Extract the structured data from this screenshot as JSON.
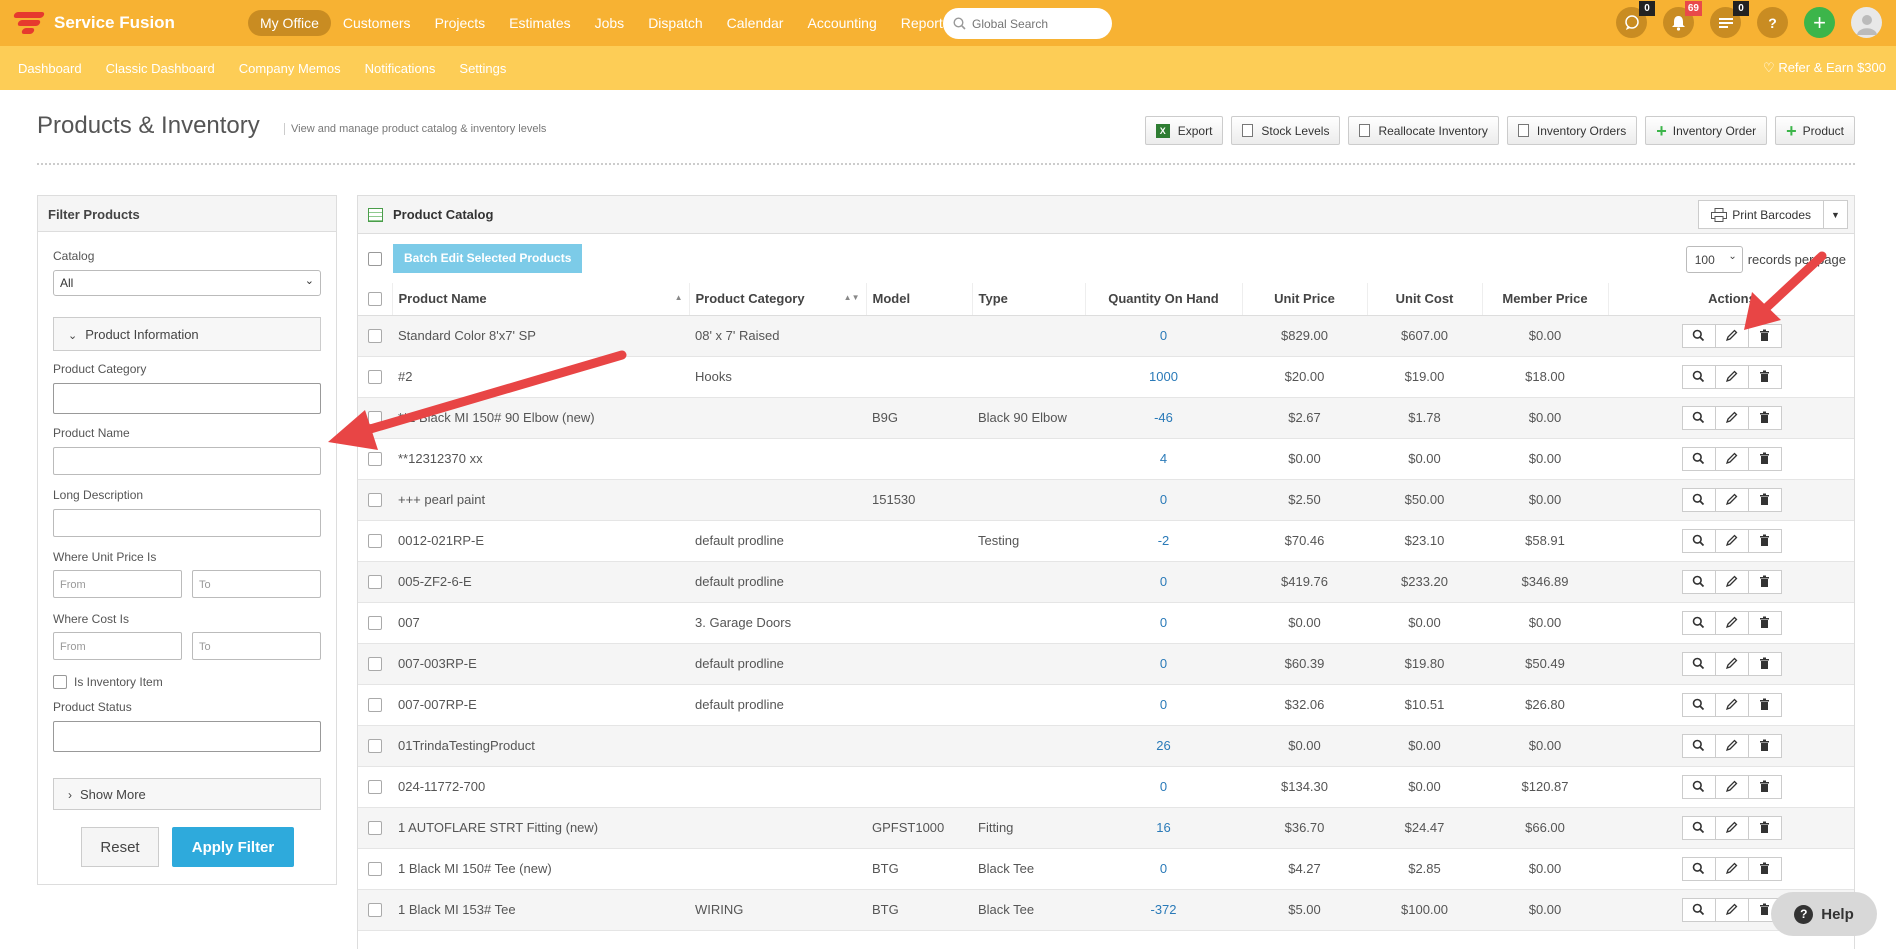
{
  "app": {
    "name": "Service Fusion"
  },
  "nav": {
    "items": [
      "My Office",
      "Customers",
      "Projects",
      "Estimates",
      "Jobs",
      "Dispatch",
      "Calendar",
      "Accounting",
      "Reports"
    ],
    "search_placeholder": "Global Search",
    "badges": {
      "chat": "0",
      "notifications": "69",
      "tasks": "0"
    },
    "help_label": "?",
    "add_label": "+"
  },
  "subnav": {
    "items": [
      "Dashboard",
      "Classic Dashboard",
      "Company Memos",
      "Notifications",
      "Settings"
    ],
    "refer": "♡ Refer & Earn $300"
  },
  "page": {
    "title": "Products & Inventory",
    "subtitle": "View and manage product catalog & inventory levels",
    "buttons": [
      "Export",
      "Stock Levels",
      "Reallocate Inventory",
      "Inventory Orders",
      "Inventory Order",
      "Product"
    ]
  },
  "filter": {
    "title": "Filter Products",
    "catalog_label": "Catalog",
    "catalog_value": "All",
    "product_info": "Product Information",
    "product_category": "Product Category",
    "product_name": "Product Name",
    "long_description": "Long Description",
    "unit_price": "Where Unit Price Is",
    "cost": "Where Cost Is",
    "from": "From",
    "to": "To",
    "inventory_item": "Is Inventory Item",
    "product_status": "Product Status",
    "show_more": "Show More",
    "reset": "Reset",
    "apply": "Apply Filter"
  },
  "catalog": {
    "title": "Product Catalog",
    "print_barcodes": "Print Barcodes",
    "batch_edit": "Batch Edit Selected Products",
    "per_page_value": "100",
    "per_page_label": "records per page",
    "columns": [
      "Product Name",
      "Product Category",
      "Model",
      "Type",
      "Quantity On Hand",
      "Unit Price",
      "Unit Cost",
      "Member Price",
      "Actions"
    ],
    "rows": [
      {
        "name": "Standard Color 8'x7' SP",
        "category": "08' x 7' Raised",
        "model": "",
        "type": "",
        "qty": "0",
        "price": "$829.00",
        "cost": "$607.00",
        "member": "$0.00"
      },
      {
        "name": "#2",
        "category": "Hooks",
        "model": "",
        "type": "",
        "qty": "1000",
        "price": "$20.00",
        "cost": "$19.00",
        "member": "$18.00"
      },
      {
        "name": "**1 Black MI 150# 90 Elbow (new)",
        "category": "",
        "model": "B9G",
        "type": "Black 90 Elbow",
        "qty": "-46",
        "price": "$2.67",
        "cost": "$1.78",
        "member": "$0.00"
      },
      {
        "name": "**12312370 xx",
        "category": "",
        "model": "",
        "type": "",
        "qty": "4",
        "price": "$0.00",
        "cost": "$0.00",
        "member": "$0.00"
      },
      {
        "name": "+++ pearl paint",
        "category": "",
        "model": "151530",
        "type": "",
        "qty": "0",
        "price": "$2.50",
        "cost": "$50.00",
        "member": "$0.00"
      },
      {
        "name": "0012-021RP-E",
        "category": "default prodline",
        "model": "",
        "type": "Testing",
        "qty": "-2",
        "price": "$70.46",
        "cost": "$23.10",
        "member": "$58.91"
      },
      {
        "name": "005-ZF2-6-E",
        "category": "default prodline",
        "model": "",
        "type": "",
        "qty": "0",
        "price": "$419.76",
        "cost": "$233.20",
        "member": "$346.89"
      },
      {
        "name": "007",
        "category": "3. Garage Doors",
        "model": "",
        "type": "",
        "qty": "0",
        "price": "$0.00",
        "cost": "$0.00",
        "member": "$0.00"
      },
      {
        "name": "007-003RP-E",
        "category": "default prodline",
        "model": "",
        "type": "",
        "qty": "0",
        "price": "$60.39",
        "cost": "$19.80",
        "member": "$50.49"
      },
      {
        "name": "007-007RP-E",
        "category": "default prodline",
        "model": "",
        "type": "",
        "qty": "0",
        "price": "$32.06",
        "cost": "$10.51",
        "member": "$26.80"
      },
      {
        "name": "01TrindaTestingProduct",
        "category": "",
        "model": "",
        "type": "",
        "qty": "26",
        "price": "$0.00",
        "cost": "$0.00",
        "member": "$0.00"
      },
      {
        "name": "024-11772-700",
        "category": "",
        "model": "",
        "type": "",
        "qty": "0",
        "price": "$134.30",
        "cost": "$0.00",
        "member": "$120.87"
      },
      {
        "name": "1 AUTOFLARE STRT Fitting (new)",
        "category": "",
        "model": "GPFST1000",
        "type": "Fitting",
        "qty": "16",
        "price": "$36.70",
        "cost": "$24.47",
        "member": "$66.00"
      },
      {
        "name": "1 Black MI 150# Tee (new)",
        "category": "",
        "model": "BTG",
        "type": "Black Tee",
        "qty": "0",
        "price": "$4.27",
        "cost": "$2.85",
        "member": "$0.00"
      },
      {
        "name": "1 Black MI 153# Tee",
        "category": "WIRING",
        "model": "BTG",
        "type": "Black Tee",
        "qty": "-372",
        "price": "$5.00",
        "cost": "$100.00",
        "member": "$0.00"
      }
    ]
  },
  "help": {
    "label": "Help",
    "icon": "?"
  },
  "colors": {
    "topbar": "#f7b233",
    "subbar": "#fdcd56",
    "apply": "#2eaadc",
    "arrow": "#e84545"
  }
}
